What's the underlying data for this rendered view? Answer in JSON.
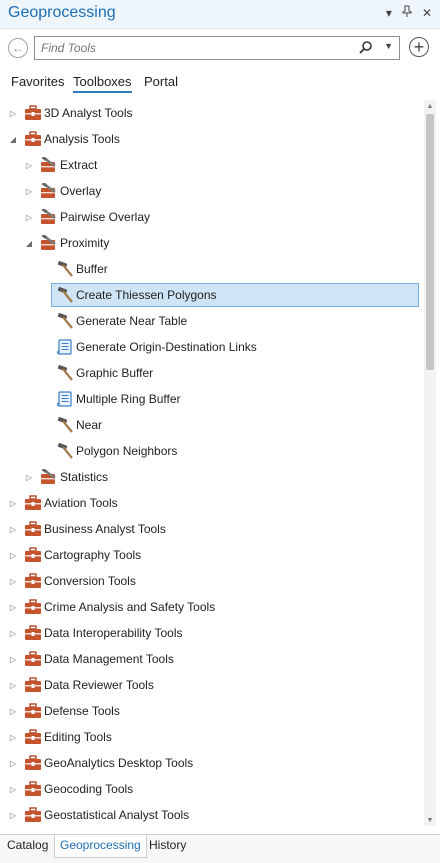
{
  "window": {
    "title": "Geoprocessing"
  },
  "search": {
    "placeholder": "Find Tools",
    "value": ""
  },
  "tabs": [
    {
      "label": "Favorites",
      "active": false
    },
    {
      "label": "Toolboxes",
      "active": true
    },
    {
      "label": "Portal",
      "active": false
    }
  ],
  "tree": [
    {
      "label": "3D Analyst Tools",
      "icon": "toolbox-icon",
      "level": 0,
      "expand": "collapsed"
    },
    {
      "label": "Analysis Tools",
      "icon": "toolbox-icon",
      "level": 0,
      "expand": "expanded"
    },
    {
      "label": "Extract",
      "icon": "toolset-icon",
      "level": 1,
      "expand": "collapsed"
    },
    {
      "label": "Overlay",
      "icon": "toolset-icon",
      "level": 1,
      "expand": "collapsed"
    },
    {
      "label": "Pairwise Overlay",
      "icon": "toolset-icon",
      "level": 1,
      "expand": "collapsed"
    },
    {
      "label": "Proximity",
      "icon": "toolset-icon",
      "level": 1,
      "expand": "expanded"
    },
    {
      "label": "Buffer",
      "icon": "hammer-icon",
      "level": 2,
      "expand": "none"
    },
    {
      "label": "Create Thiessen Polygons",
      "icon": "hammer-icon",
      "level": 2,
      "expand": "none",
      "selected": true
    },
    {
      "label": "Generate Near Table",
      "icon": "hammer-icon",
      "level": 2,
      "expand": "none"
    },
    {
      "label": "Generate Origin-Destination Links",
      "icon": "script-icon",
      "level": 2,
      "expand": "none"
    },
    {
      "label": "Graphic Buffer",
      "icon": "hammer-icon",
      "level": 2,
      "expand": "none"
    },
    {
      "label": "Multiple Ring Buffer",
      "icon": "script-icon",
      "level": 2,
      "expand": "none"
    },
    {
      "label": "Near",
      "icon": "hammer-icon",
      "level": 2,
      "expand": "none"
    },
    {
      "label": "Polygon Neighbors",
      "icon": "hammer-icon",
      "level": 2,
      "expand": "none"
    },
    {
      "label": "Statistics",
      "icon": "toolset-icon",
      "level": 1,
      "expand": "collapsed"
    },
    {
      "label": "Aviation Tools",
      "icon": "toolbox-icon",
      "level": 0,
      "expand": "collapsed"
    },
    {
      "label": "Business Analyst Tools",
      "icon": "toolbox-icon",
      "level": 0,
      "expand": "collapsed"
    },
    {
      "label": "Cartography Tools",
      "icon": "toolbox-icon",
      "level": 0,
      "expand": "collapsed"
    },
    {
      "label": "Conversion Tools",
      "icon": "toolbox-icon",
      "level": 0,
      "expand": "collapsed"
    },
    {
      "label": "Crime Analysis and Safety Tools",
      "icon": "toolbox-icon",
      "level": 0,
      "expand": "collapsed"
    },
    {
      "label": "Data Interoperability Tools",
      "icon": "toolbox-icon",
      "level": 0,
      "expand": "collapsed"
    },
    {
      "label": "Data Management Tools",
      "icon": "toolbox-icon",
      "level": 0,
      "expand": "collapsed"
    },
    {
      "label": "Data Reviewer Tools",
      "icon": "toolbox-icon",
      "level": 0,
      "expand": "collapsed"
    },
    {
      "label": "Defense Tools",
      "icon": "toolbox-icon",
      "level": 0,
      "expand": "collapsed"
    },
    {
      "label": "Editing Tools",
      "icon": "toolbox-icon",
      "level": 0,
      "expand": "collapsed"
    },
    {
      "label": "GeoAnalytics Desktop Tools",
      "icon": "toolbox-icon",
      "level": 0,
      "expand": "collapsed"
    },
    {
      "label": "Geocoding Tools",
      "icon": "toolbox-icon",
      "level": 0,
      "expand": "collapsed"
    },
    {
      "label": "Geostatistical Analyst Tools",
      "icon": "toolbox-icon",
      "level": 0,
      "expand": "collapsed"
    }
  ],
  "bottom_tabs": [
    {
      "label": "Catalog",
      "active": false
    },
    {
      "label": "Geoprocessing",
      "active": true
    },
    {
      "label": "History",
      "active": false
    }
  ],
  "colors": {
    "accent": "#1d6fb5",
    "selection": "#cfe4f4",
    "toolbox": "#c4532e"
  }
}
